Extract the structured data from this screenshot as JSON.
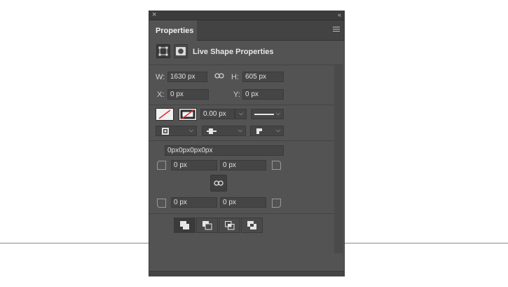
{
  "panel": {
    "close_glyph": "×",
    "collapse_glyph": "‹‹",
    "tab_label": "Properties",
    "menu_icon": "hamburger-menu-icon"
  },
  "header": {
    "title": "Live Shape Properties",
    "icons": [
      "transform-bounds-icon",
      "mask-icon"
    ]
  },
  "transform": {
    "w_label": "W:",
    "w_value": "1630 px",
    "h_label": "H:",
    "h_value": "605 px",
    "x_label": "X:",
    "x_value": "0 px",
    "y_label": "Y:",
    "y_value": "0 px",
    "link_icon": "link-icon"
  },
  "appearance": {
    "fill_icon": "no-fill-swatch-icon",
    "stroke_icon": "stroke-swatch-icon",
    "stroke_width": "0.00 px",
    "stroke_style_icon": "line-style-icon",
    "align_icon": "stroke-align-icon",
    "cap_icon": "stroke-cap-icon",
    "corner_icon": "stroke-corner-icon"
  },
  "corners": {
    "summary": "0px0px0px0px",
    "top_left": "0 px",
    "top_right": "0 px",
    "bottom_left": "0 px",
    "bottom_right": "0 px",
    "link_icon": "link-corners-icon"
  },
  "pathfinder": {
    "icons": [
      "combine-shapes-icon",
      "subtract-front-icon",
      "intersect-shapes-icon",
      "exclude-overlap-icon"
    ]
  }
}
